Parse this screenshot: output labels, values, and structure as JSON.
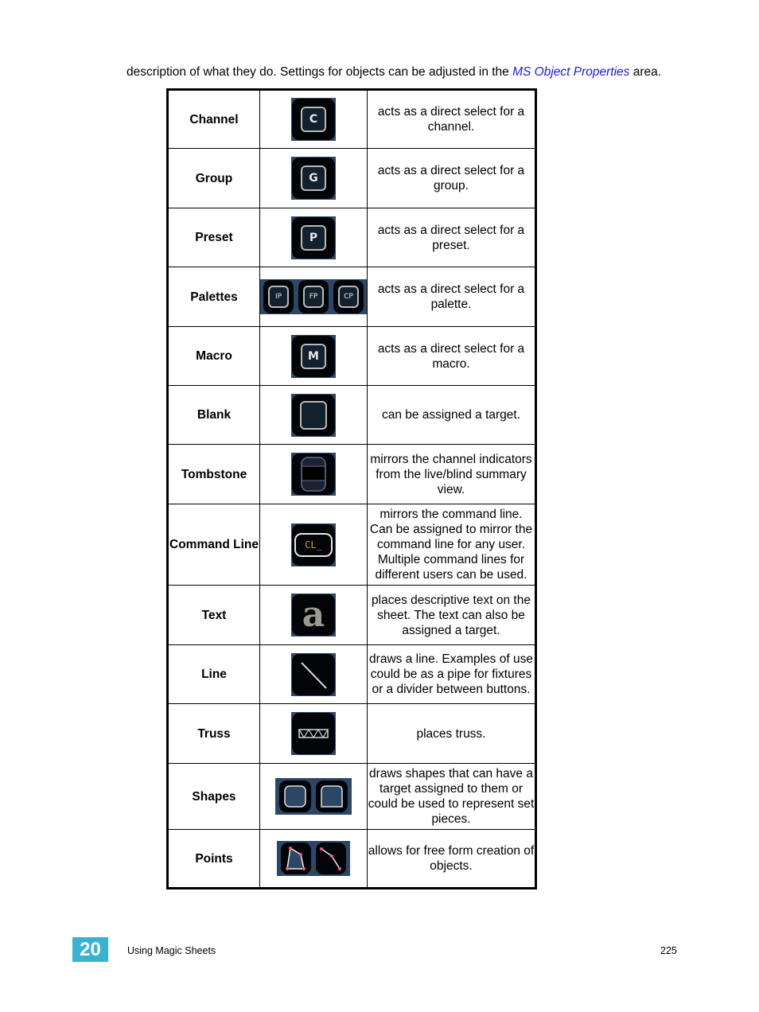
{
  "intro": {
    "text_before": "description of what they do. Settings for objects can be adjusted in the ",
    "link": "MS Object Properties",
    "text_after": " area."
  },
  "rows": [
    {
      "name": "Channel",
      "icon": "channel-icon",
      "icon_label": "C",
      "desc": "acts as a direct select for a channel."
    },
    {
      "name": "Group",
      "icon": "group-icon",
      "icon_label": "G",
      "desc": "acts as a direct select for a group."
    },
    {
      "name": "Preset",
      "icon": "preset-icon",
      "icon_label": "P",
      "desc": "acts as a direct select for a preset."
    },
    {
      "name": "Palettes",
      "icon": "palettes-icon",
      "icon_labels": [
        "IP",
        "FP",
        "CP"
      ],
      "desc": "acts as a direct select for a palette."
    },
    {
      "name": "Macro",
      "icon": "macro-icon",
      "icon_label": "M",
      "desc": "acts as a direct select for a macro."
    },
    {
      "name": "Blank",
      "icon": "blank-icon",
      "desc": "can be assigned a target."
    },
    {
      "name": "Tombstone",
      "icon": "tombstone-icon",
      "desc": "mirrors the channel indicators from the live/blind summary view."
    },
    {
      "name": "Command Line",
      "icon": "command-line-icon",
      "icon_label": "CL_",
      "desc": "mirrors the command line. Can be assigned to mirror the command line for any user. Multiple command lines for different users can be used."
    },
    {
      "name": "Text",
      "icon": "text-icon",
      "icon_label": "a",
      "desc": "places descriptive text on the sheet. The text can also be assigned a target."
    },
    {
      "name": "Line",
      "icon": "line-icon",
      "desc": "draws a line. Examples of use could be as a pipe for fixtures or a divider between buttons."
    },
    {
      "name": "Truss",
      "icon": "truss-icon",
      "desc": "places truss."
    },
    {
      "name": "Shapes",
      "icon": "shapes-icon",
      "desc": "draws shapes that can have a target assigned to them or could be used to represent set pieces."
    },
    {
      "name": "Points",
      "icon": "points-icon",
      "desc": "allows for free form creation of objects."
    }
  ],
  "colors": {
    "link": "#1a1adc",
    "chapter_badge": "#3ab3d3",
    "icon_background": "#2c4766",
    "command_line_text": "#d4a017",
    "point_marker": "#ff4f8b"
  },
  "footer": {
    "chapter": "20",
    "title": "Using Magic Sheets",
    "page": "225"
  }
}
